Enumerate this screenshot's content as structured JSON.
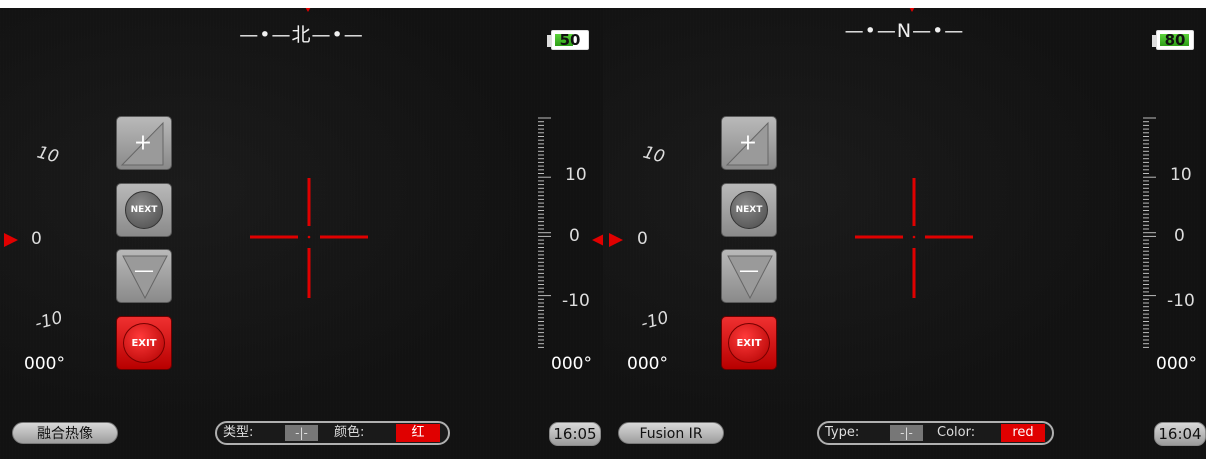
{
  "panels": [
    {
      "compass": "—•—北—•—",
      "battery": {
        "label": "50",
        "level": 0.5
      },
      "left_scale": {
        "top": "10",
        "mid": "0",
        "bottom": "-10"
      },
      "right_scale": {
        "top": "10",
        "mid": "0",
        "bottom": "-10"
      },
      "heading_left": "000°",
      "heading_right": "000°",
      "buttons": {
        "zoom_in": "+",
        "next": "NEXT",
        "zoom_out": "—",
        "exit": "EXIT"
      },
      "mode_label": "融合热像",
      "settings": {
        "type_label": "类型:",
        "type_value": "-|-",
        "color_label": "颜色:",
        "color_value": "红"
      },
      "time": "16:05"
    },
    {
      "compass": "—•—N—•—",
      "battery": {
        "label": "80",
        "level": 0.8
      },
      "left_scale": {
        "top": "10",
        "mid": "0",
        "bottom": "-10"
      },
      "right_scale": {
        "top": "10",
        "mid": "0",
        "bottom": "-10"
      },
      "heading_left": "000°",
      "heading_right": "000°",
      "buttons": {
        "zoom_in": "+",
        "next": "NEXT",
        "zoom_out": "—",
        "exit": "EXIT"
      },
      "mode_label": "Fusion IR",
      "settings": {
        "type_label": "Type:",
        "type_value": "-|-",
        "color_label": "Color:",
        "color_value": "red"
      },
      "time": "16:04"
    }
  ],
  "colors": {
    "reticle": "#e00000",
    "accent": "#e00000",
    "battery_green": "#3ec21f"
  }
}
